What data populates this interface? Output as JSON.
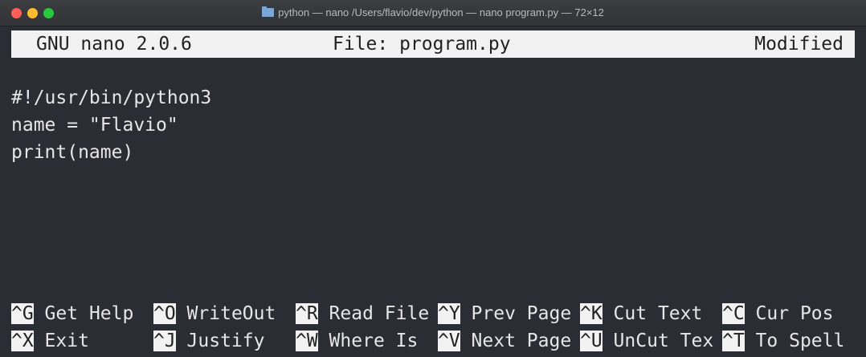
{
  "window": {
    "title": "python — nano /Users/flavio/dev/python — nano program.py — 72×12"
  },
  "header": {
    "app": "GNU nano 2.0.6",
    "file": "File: program.py",
    "status": "Modified"
  },
  "editor": {
    "lines": [
      "#!/usr/bin/python3",
      "name = \"Flavio\"",
      "print(name)"
    ]
  },
  "shortcuts": [
    [
      {
        "key": "^G",
        "label": " Get Help "
      },
      {
        "key": "^O",
        "label": " WriteOut "
      },
      {
        "key": "^R",
        "label": " Read File"
      },
      {
        "key": "^Y",
        "label": " Prev Page"
      },
      {
        "key": "^K",
        "label": " Cut Text "
      },
      {
        "key": "^C",
        "label": " Cur Pos"
      }
    ],
    [
      {
        "key": "^X",
        "label": " Exit     "
      },
      {
        "key": "^J",
        "label": " Justify  "
      },
      {
        "key": "^W",
        "label": " Where Is "
      },
      {
        "key": "^V",
        "label": " Next Page"
      },
      {
        "key": "^U",
        "label": " UnCut Tex"
      },
      {
        "key": "^T",
        "label": " To Spell"
      }
    ]
  ]
}
